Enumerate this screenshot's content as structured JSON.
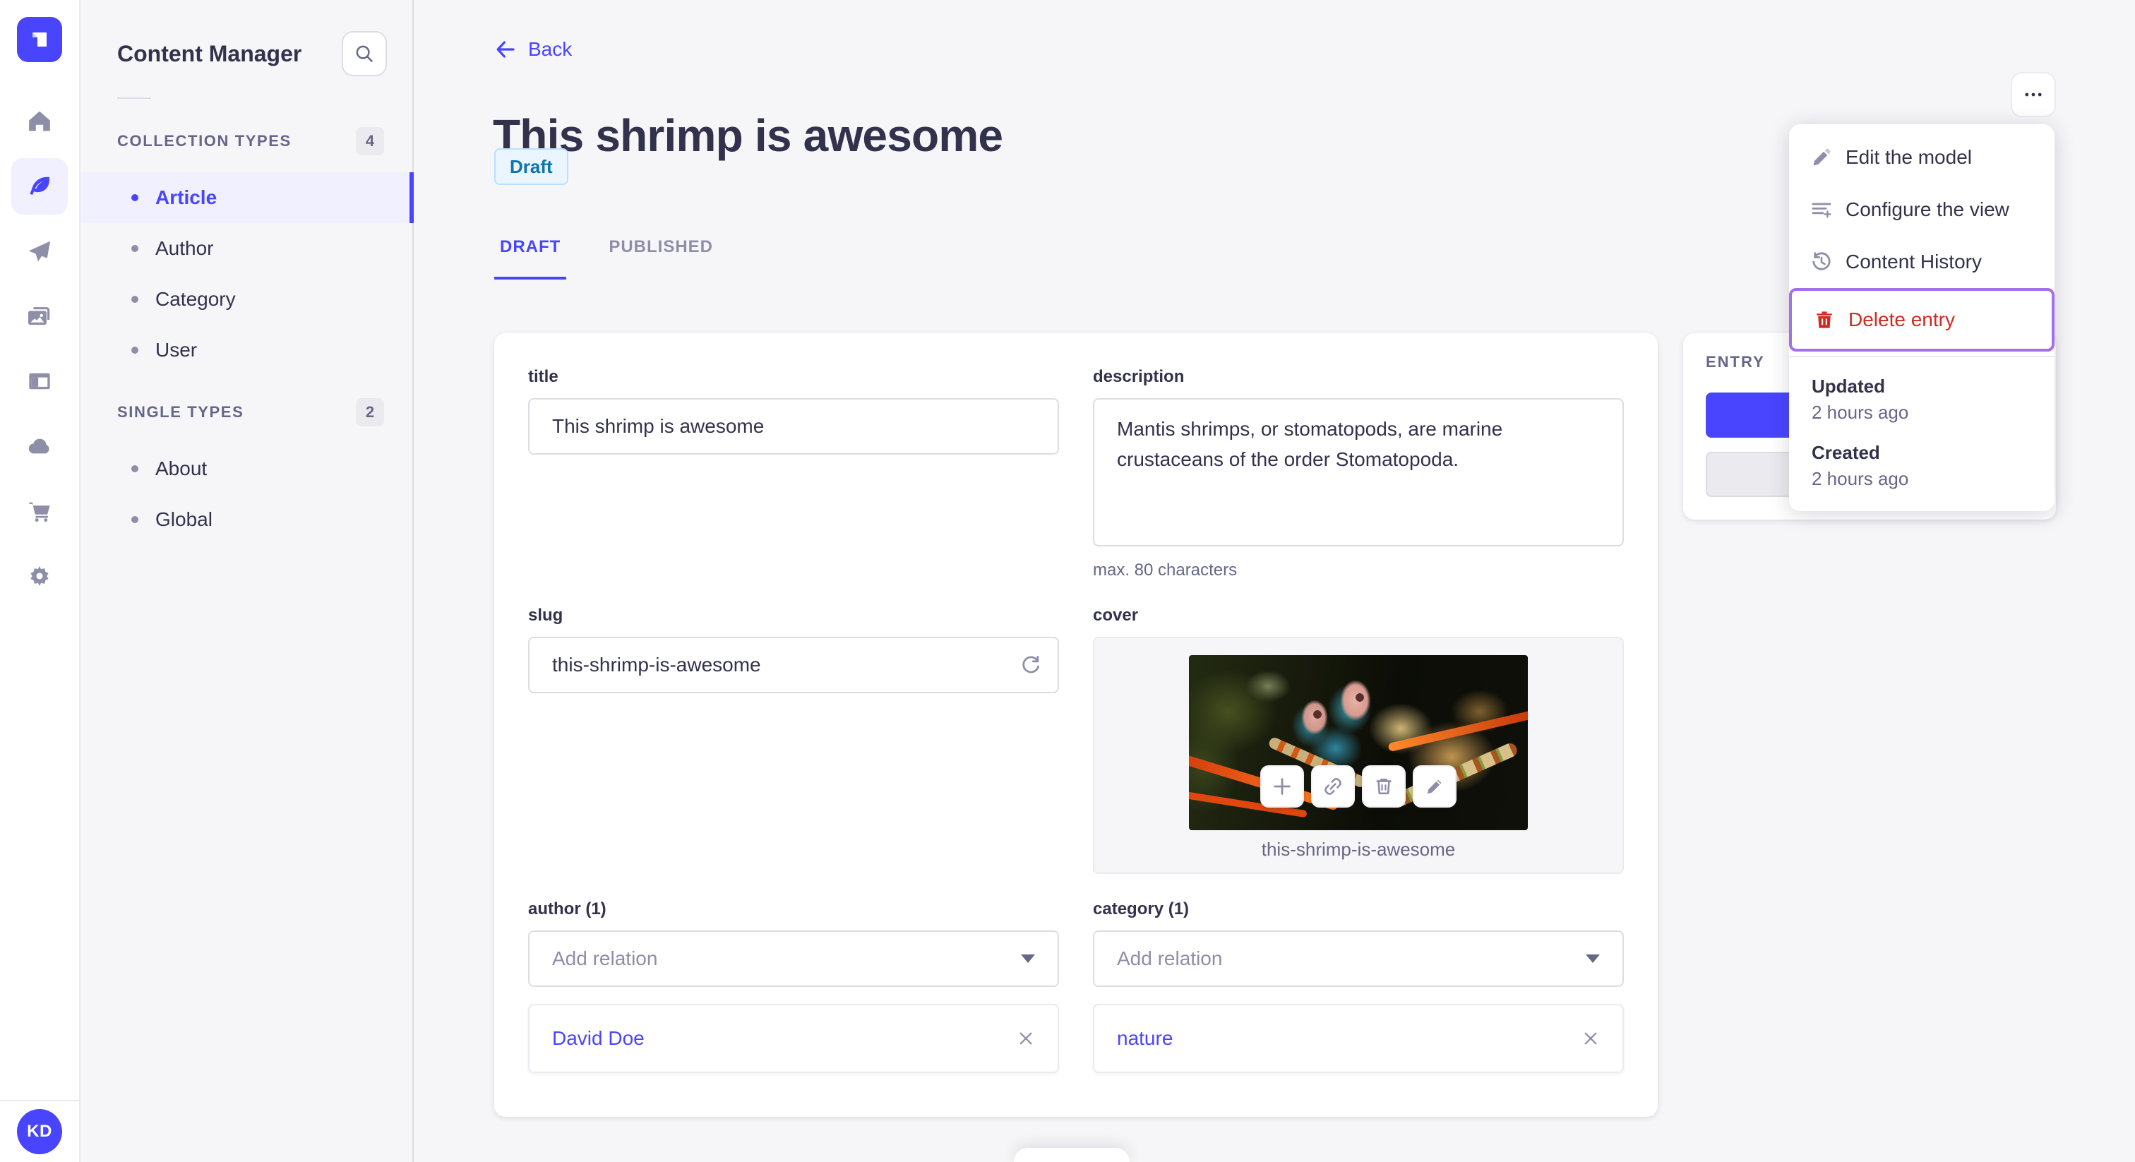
{
  "nav": {
    "avatar_initials": "KD",
    "icons": [
      "home",
      "content-manager",
      "releases",
      "media-library",
      "content-type-builder",
      "cloud",
      "marketplace",
      "settings"
    ]
  },
  "sidebar": {
    "title": "Content Manager",
    "sections": [
      {
        "label": "COLLECTION TYPES",
        "badge": "4",
        "items": [
          {
            "label": "Article",
            "active": true
          },
          {
            "label": "Author",
            "active": false
          },
          {
            "label": "Category",
            "active": false
          },
          {
            "label": "User",
            "active": false
          }
        ]
      },
      {
        "label": "SINGLE TYPES",
        "badge": "2",
        "items": [
          {
            "label": "About",
            "active": false
          },
          {
            "label": "Global",
            "active": false
          }
        ]
      }
    ]
  },
  "header": {
    "back_label": "Back",
    "title": "This shrimp is awesome",
    "status_badge": "Draft",
    "more_label": "...",
    "tabs": [
      {
        "label": "DRAFT",
        "active": true
      },
      {
        "label": "PUBLISHED",
        "active": false
      }
    ]
  },
  "form": {
    "title": {
      "label": "title",
      "value": "This shrimp is awesome"
    },
    "description": {
      "label": "description",
      "value": "Mantis shrimps, or stomatopods, are marine crustaceans of the order Stomatopoda.",
      "helper": "max. 80 characters"
    },
    "slug": {
      "label": "slug",
      "value": "this-shrimp-is-awesome"
    },
    "cover": {
      "label": "cover",
      "caption": "this-shrimp-is-awesome"
    },
    "author": {
      "label": "author (1)",
      "placeholder": "Add relation",
      "relation": "David Doe"
    },
    "category": {
      "label": "category (1)",
      "placeholder": "Add relation",
      "relation": "nature"
    }
  },
  "entry_panel": {
    "title": "ENTRY"
  },
  "menu": {
    "items": [
      {
        "label": "Edit the model",
        "icon": "pencil-icon"
      },
      {
        "label": "Configure the view",
        "icon": "configure-icon"
      },
      {
        "label": "Content History",
        "icon": "history-icon"
      },
      {
        "label": "Delete entry",
        "icon": "trash-icon",
        "danger": true,
        "focused": true
      }
    ],
    "info": [
      {
        "label": "Updated",
        "value": "2 hours ago"
      },
      {
        "label": "Created",
        "value": "2 hours ago"
      }
    ]
  },
  "colors": {
    "accent": "#4945ff",
    "accent_bg": "#f0f0ff",
    "danger": "#d02b20",
    "focus_ring": "#a56eeb",
    "draft_text": "#0c75af",
    "draft_bg": "#eaf5ff",
    "draft_border": "#b8e1ff",
    "text_primary": "#32324d",
    "text_secondary": "#666687",
    "text_muted": "#8e8ea9",
    "background": "#f6f6f9",
    "border": "#dcdce4"
  }
}
